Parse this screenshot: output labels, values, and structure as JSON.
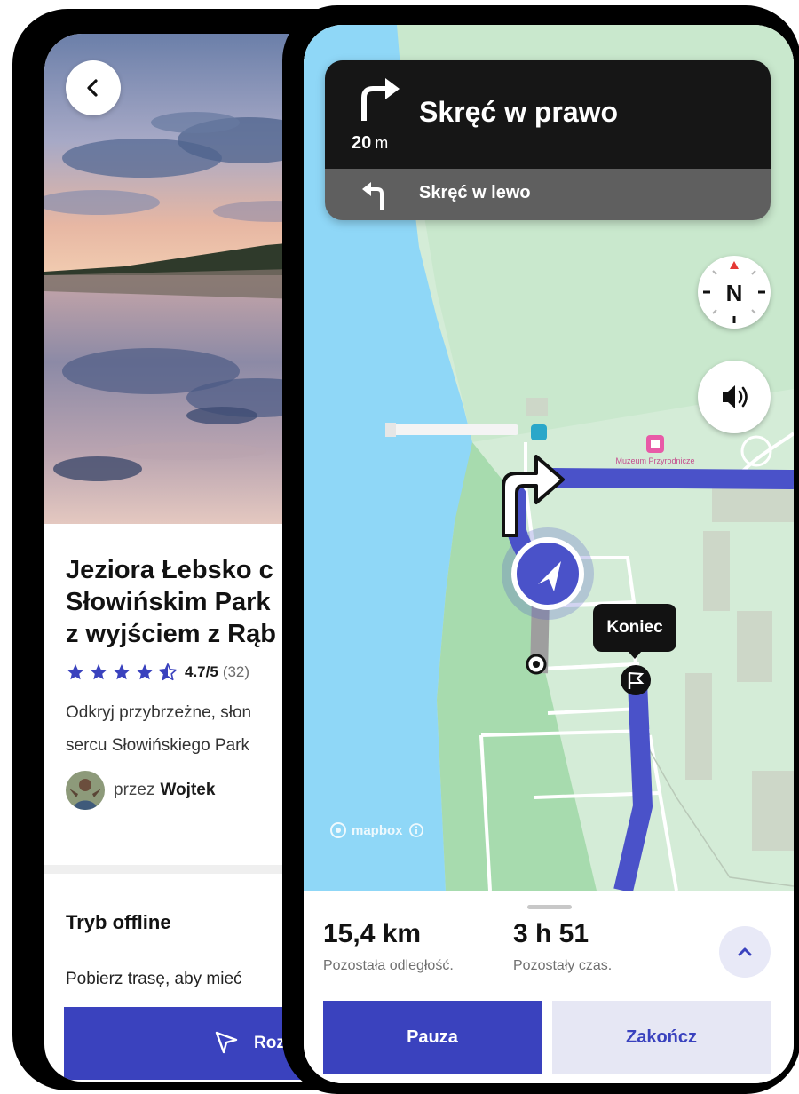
{
  "colors": {
    "primary": "#3a42be",
    "route": "#4a52c9",
    "water": "#8fd7f7",
    "land": "#d4ecd7",
    "nav_dark": "#161616",
    "nav_next": "#5f5f5f",
    "secondary_button_bg": "#e6e7f4"
  },
  "details_screen": {
    "title": "Jeziora Łebsko c\nSłowińskim Park\nz wyjściem z Rąb",
    "rating": {
      "stars_filled": 4.5,
      "value": "4.7/5",
      "count": "(32)"
    },
    "description": "Odkryj przybrzeżne, słon\nsercu Słowińskiego Park",
    "author": {
      "prefix": "przez",
      "name": "Wojtek"
    },
    "offline": {
      "title": "Tryb offline",
      "text": "Pobierz trasę, aby mieć"
    },
    "start_button": {
      "label": "Rozp",
      "icon": "navigation-arrow-icon"
    }
  },
  "navigation_screen": {
    "instruction": {
      "text": "Skręć w prawo",
      "distance_value": "20",
      "distance_unit": "m",
      "icon": "turn-right-icon"
    },
    "next_instruction": {
      "text": "Skręć w lewo",
      "icon": "turn-left-icon"
    },
    "compass_letter": "N",
    "sound_icon": "speaker-icon",
    "map": {
      "end_marker_label": "Koniec",
      "poi_label": "Muzeum Przyrodnicze",
      "attribution": "mapbox"
    },
    "bottom_sheet": {
      "remaining_distance": "15,4 km",
      "remaining_distance_label": "Pozostała odległość.",
      "remaining_time": "3 h 51",
      "remaining_time_label": "Pozostały czas.",
      "pause_label": "Pauza",
      "finish_label": "Zakończ"
    }
  }
}
